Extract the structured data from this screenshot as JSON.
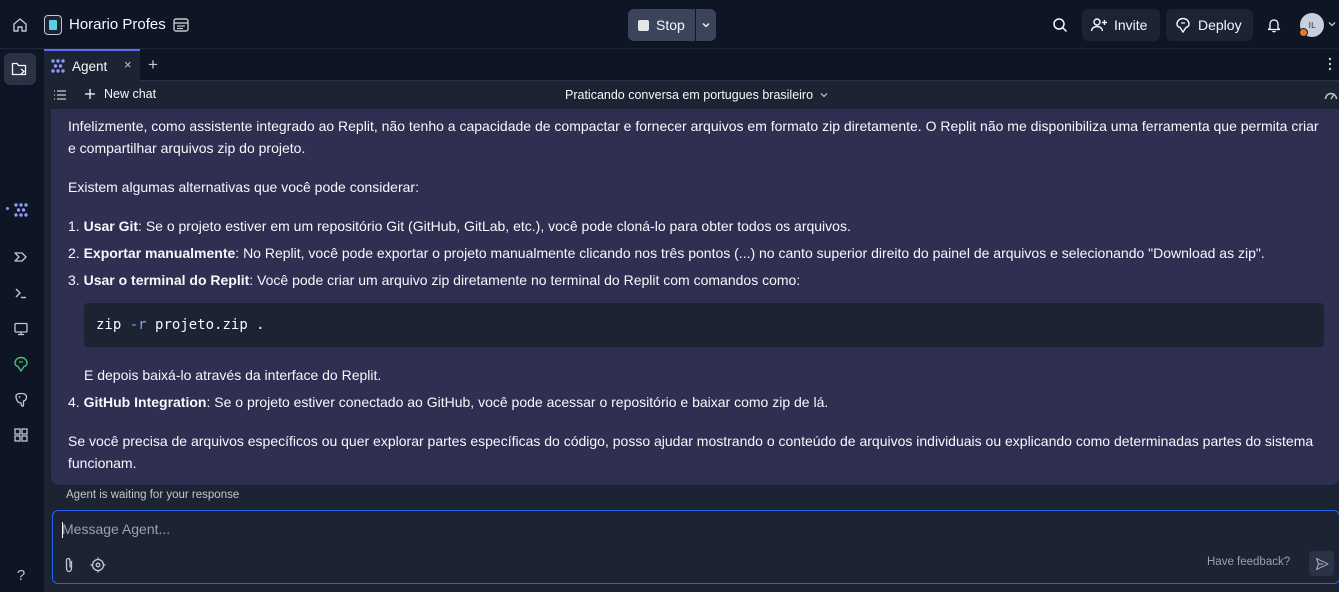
{
  "topbar": {
    "repl_name": "Horario Profes",
    "stop_label": "Stop",
    "invite_label": "Invite",
    "deploy_label": "Deploy",
    "avatar_initials": "IL"
  },
  "tabs": [
    {
      "label": "Agent",
      "close": "×"
    }
  ],
  "tab_add": "+",
  "chatbar": {
    "new_chat_label": "New chat",
    "title": "Praticando conversa em portugues brasileiro"
  },
  "message": {
    "p1": "Infelizmente, como assistente integrado ao Replit, não tenho a capacidade de compactar e fornecer arquivos em formato zip diretamente. O Replit não me disponibiliza uma ferramenta que permita criar e compartilhar arquivos zip do projeto.",
    "p2": "Existem algumas alternativas que você pode considerar:",
    "items": [
      {
        "num": "1.",
        "bold": "Usar Git",
        "text": ": Se o projeto estiver em um repositório Git (GitHub, GitLab, etc.), você pode cloná-lo para obter todos os arquivos."
      },
      {
        "num": "2.",
        "bold": "Exportar manualmente",
        "text": ": No Replit, você pode exportar o projeto manualmente clicando nos três pontos (...) no canto superior direito do painel de arquivos e selecionando \"Download as zip\"."
      },
      {
        "num": "3.",
        "bold": "Usar o terminal do Replit",
        "text": ": Você pode criar um arquivo zip diretamente no terminal do Replit com comandos como:"
      },
      {
        "num": "4.",
        "bold": "GitHub Integration",
        "text": ": Se o projeto estiver conectado ao GitHub, você pode acessar o repositório e baixar como zip de lá."
      }
    ],
    "code": {
      "cmd": "zip",
      "flag": "-r",
      "args": "projeto.zip ."
    },
    "after_code": "E depois baixá-lo através da interface do Replit.",
    "p3": "Se você precisa de arquivos específicos ou quer explorar partes específicas do código, posso ajudar mostrando o conteúdo de arquivos individuais ou explicando como determinadas partes do sistema funcionam."
  },
  "status_text": "Agent is waiting for your response",
  "input": {
    "placeholder": "Message Agent...",
    "feedback": "Have feedback?"
  },
  "help_label": "?"
}
